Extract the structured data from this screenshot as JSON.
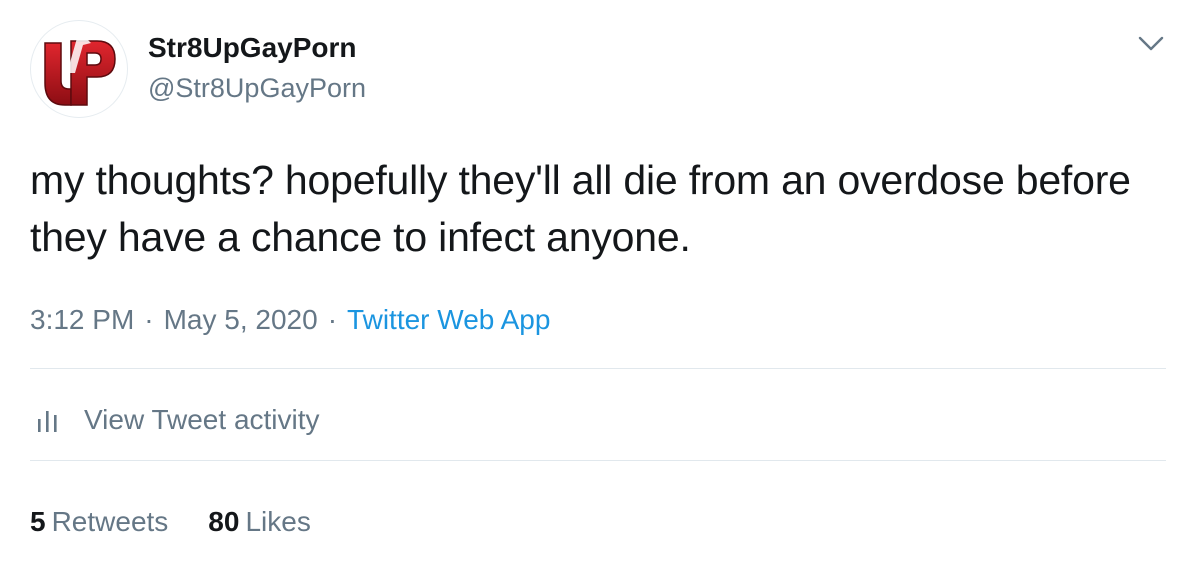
{
  "author": {
    "display_name": "Str8UpGayPorn",
    "handle": "@Str8UpGayPorn",
    "avatar_logo_text": "UP"
  },
  "tweet": {
    "text": "my thoughts? hopefully they'll all die from an overdose before they have a chance to infect anyone.",
    "time": "3:12 PM",
    "separator": "·",
    "date": "May 5, 2020",
    "source": "Twitter Web App"
  },
  "activity": {
    "label": "View Tweet activity",
    "icon": "bar-chart-icon"
  },
  "stats": {
    "retweets_count": "5",
    "retweets_label": "Retweets",
    "likes_count": "80",
    "likes_label": "Likes"
  },
  "colors": {
    "text_primary": "#14171a",
    "text_secondary": "#657786",
    "link": "#1b95e0",
    "divider": "#e1e8ed",
    "logo_red": "#b3121b"
  }
}
